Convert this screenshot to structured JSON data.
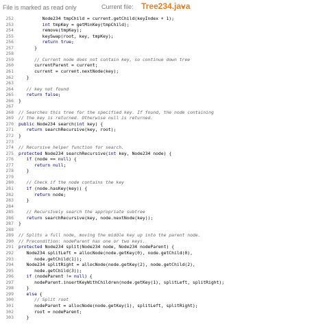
{
  "header": {
    "readonly_text": "File is marked as read only",
    "current_file_label": "Current file:",
    "current_file_name": "Tree234.java"
  },
  "lines": [
    {
      "n": "252",
      "t": "         Node234 tmpChild = current.getChild(keyIndex + 1);"
    },
    {
      "n": "253",
      "t": "         int tmpKey = getMinKey(tmpChild);"
    },
    {
      "n": "254",
      "t": "         remove(tmpKey);"
    },
    {
      "n": "255",
      "t": "         keySwap(root, key, tmpKey);"
    },
    {
      "n": "256",
      "t": "         return true;"
    },
    {
      "n": "257",
      "t": "      }"
    },
    {
      "n": "258",
      "t": ""
    },
    {
      "n": "259",
      "t": "      // Current node does not contain key, so continue down tree"
    },
    {
      "n": "260",
      "t": "      currentParent = current;"
    },
    {
      "n": "261",
      "t": "      current = current.nextNode(key);"
    },
    {
      "n": "262",
      "t": "   }"
    },
    {
      "n": "263",
      "t": ""
    },
    {
      "n": "264",
      "t": "   // key not found"
    },
    {
      "n": "265",
      "t": "   return false;"
    },
    {
      "n": "266",
      "t": "}"
    },
    {
      "n": "267",
      "t": ""
    },
    {
      "n": "268",
      "t": "// Searches this tree for the specified key. If found, the node containing"
    },
    {
      "n": "269",
      "t": "// the key is returned. Otherwise null is returned."
    },
    {
      "n": "270",
      "t": "public Node234 search(int key) {"
    },
    {
      "n": "271",
      "t": "   return searchRecursive(key, root);"
    },
    {
      "n": "272",
      "t": "}"
    },
    {
      "n": "273",
      "t": ""
    },
    {
      "n": "274",
      "t": "// Recursive helper function for search."
    },
    {
      "n": "275",
      "t": "protected Node234 searchRecursive(int key, Node234 node) {"
    },
    {
      "n": "276",
      "t": "   if (node == null) {"
    },
    {
      "n": "277",
      "t": "      return null;"
    },
    {
      "n": "278",
      "t": "   }"
    },
    {
      "n": "279",
      "t": ""
    },
    {
      "n": "280",
      "t": "   // Check if the node contains the key"
    },
    {
      "n": "281",
      "t": "   if (node.hasKey(key)) {"
    },
    {
      "n": "282",
      "t": "      return node;"
    },
    {
      "n": "283",
      "t": "   }"
    },
    {
      "n": "284",
      "t": ""
    },
    {
      "n": "285",
      "t": "   // Recursively search the appropriate subtree"
    },
    {
      "n": "286",
      "t": "   return searchRecursive(key, node.nextNode(key));"
    },
    {
      "n": "287",
      "t": "}"
    },
    {
      "n": "288",
      "t": ""
    },
    {
      "n": "289",
      "t": "// Splits a full node, moving the middle key up into the parent node."
    },
    {
      "n": "290",
      "t": "// Precondition: nodeParent has one or two keys."
    },
    {
      "n": "291",
      "t": "protected Node234 split(Node234 node, Node234 nodeParent) {"
    },
    {
      "n": "292",
      "t": "   Node234 splitLeft = allocNode(node.getKey(0), node.getChild(0),"
    },
    {
      "n": "293",
      "t": "      node.getChild(1));"
    },
    {
      "n": "294",
      "t": "   Node234 splitRight = allocNode(node.getKey(2), node.getChild(2),"
    },
    {
      "n": "295",
      "t": "      node.getChild(3));"
    },
    {
      "n": "296",
      "t": "   if (nodeParent != null) {"
    },
    {
      "n": "297",
      "t": "      nodeParent.insertKeyWithChildren(node.getKey(1), splitLeft, splitRight);"
    },
    {
      "n": "298",
      "t": "   }"
    },
    {
      "n": "299",
      "t": "   else {"
    },
    {
      "n": "300",
      "t": "      // Split root"
    },
    {
      "n": "301",
      "t": "      nodeParent = allocNode(node.getKey(1), splitLeft, splitRight);"
    },
    {
      "n": "302",
      "t": "      root = nodeParent;"
    },
    {
      "n": "303",
      "t": "   }"
    }
  ]
}
